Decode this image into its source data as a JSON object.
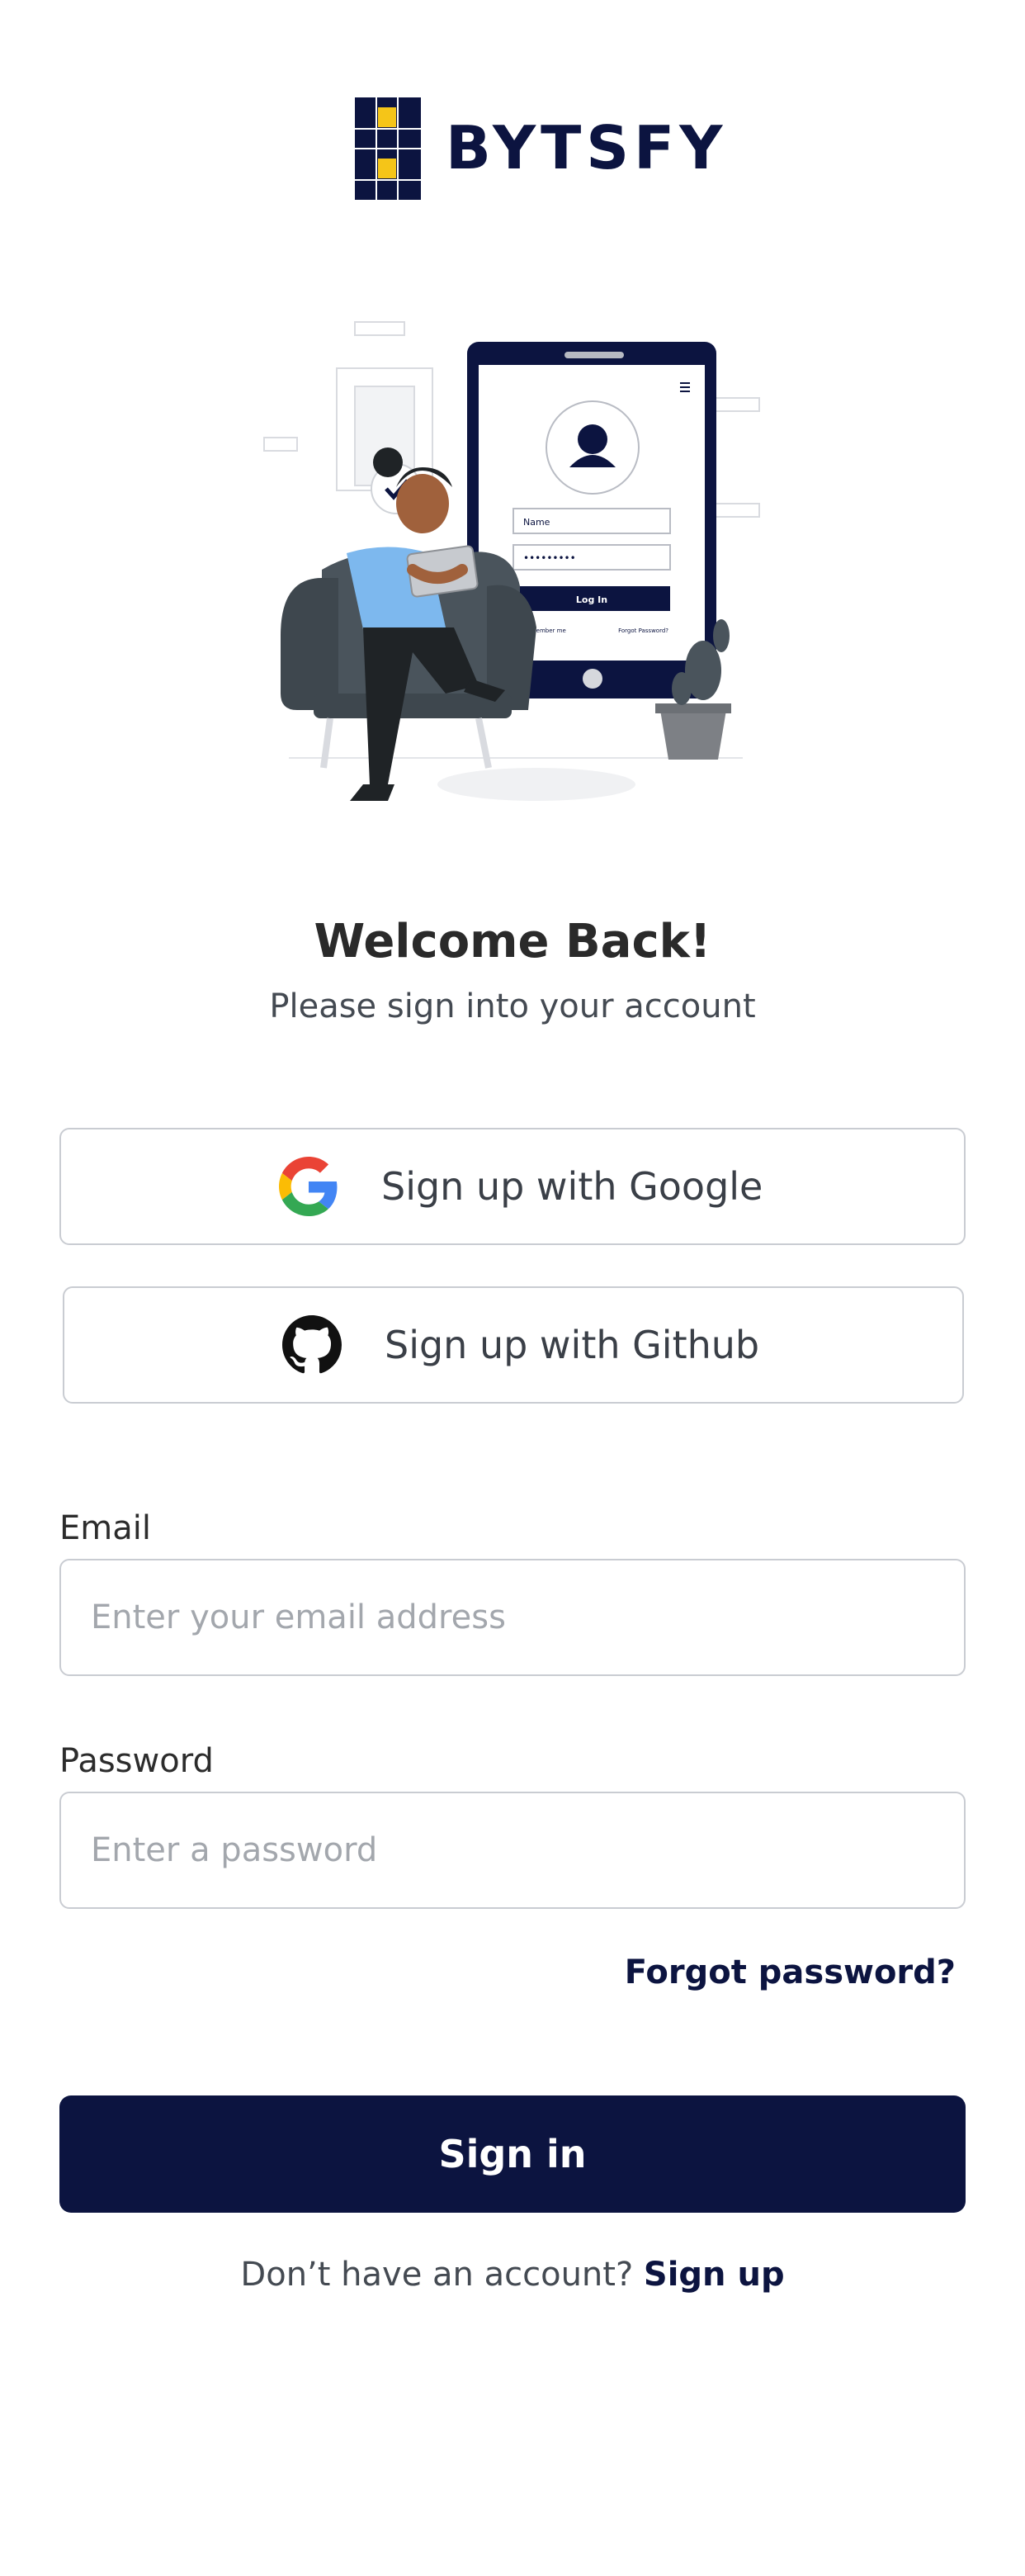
{
  "brand": {
    "name": "BYTSFY",
    "colors": {
      "primary": "#0c1440",
      "accent": "#f5c518"
    }
  },
  "illustration": {
    "name": "person-login-illustration",
    "phone": {
      "name_field": "Name",
      "password_dots": "•••••••••",
      "login_button": "Log In",
      "remember_me": "Remember me",
      "forgot": "Forgot Password?"
    }
  },
  "heading": {
    "title": "Welcome Back!",
    "subtitle": "Please sign into your account"
  },
  "oauth": {
    "google": {
      "label": "Sign up with Google",
      "icon": "google-icon"
    },
    "github": {
      "label": "Sign up with Github",
      "icon": "github-icon"
    }
  },
  "form": {
    "email": {
      "label": "Email",
      "placeholder": "Enter your email address",
      "value": ""
    },
    "password": {
      "label": "Password",
      "placeholder": "Enter a password",
      "value": ""
    },
    "forgot_label": "Forgot password?",
    "submit_label": "Sign in"
  },
  "footer": {
    "prompt": "Don’t have an account?",
    "link_label": "Sign up"
  }
}
